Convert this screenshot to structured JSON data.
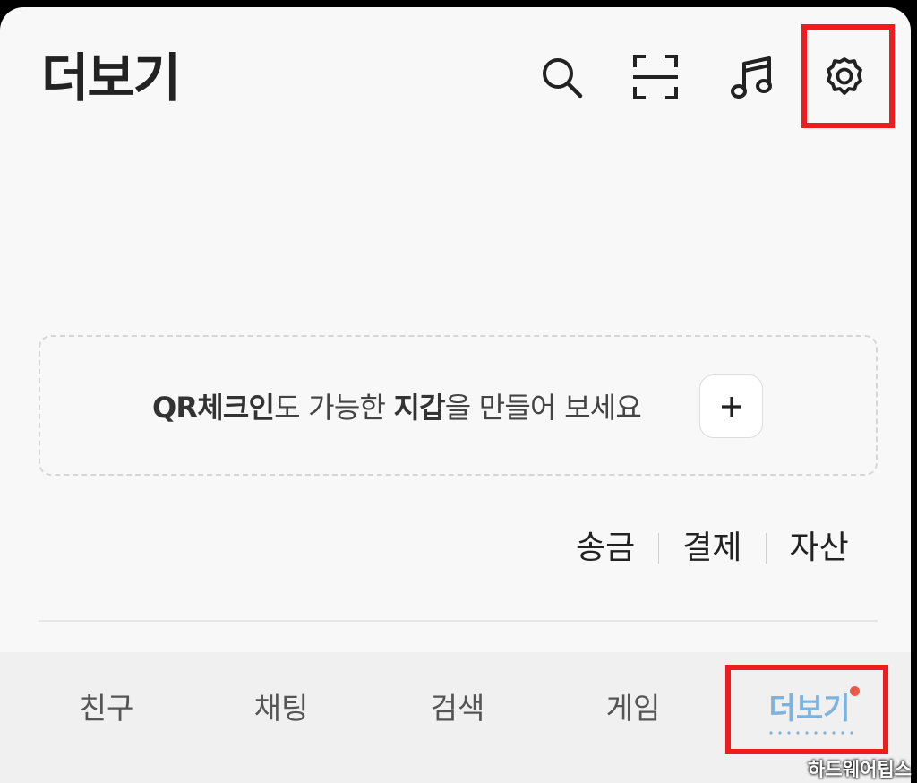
{
  "header": {
    "title": "더보기",
    "icons": [
      "search-icon",
      "qr-scan-icon",
      "music-icon",
      "gear-icon"
    ]
  },
  "wallet": {
    "text_bold_1": "QR체크인",
    "text_normal_1": "도 가능한 ",
    "text_bold_2": "지갑",
    "text_normal_2": "을 만들어 보세요",
    "add_button_label": "+"
  },
  "wallet_links": {
    "send": "송금",
    "pay": "결제",
    "assets": "자산"
  },
  "tabbar": {
    "tabs": [
      {
        "label": "친구"
      },
      {
        "label": "채팅"
      },
      {
        "label": "검색"
      },
      {
        "label": "게임"
      },
      {
        "label": "더보기"
      }
    ],
    "active_index": 4
  },
  "watermark": "하드웨어팁스",
  "colors": {
    "highlight": "#ee1c1c",
    "active_tab": "#7eb3dd",
    "badge": "#ea5a4a"
  }
}
